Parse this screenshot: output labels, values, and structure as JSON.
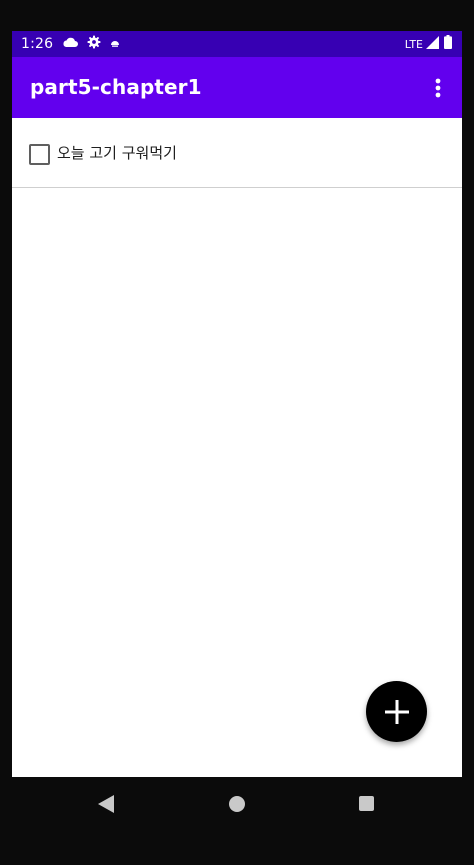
{
  "status_bar": {
    "time": "1:26",
    "network": "LTE",
    "icons": [
      "cloud-icon",
      "gear-icon",
      "sync-icon",
      "signal-icon",
      "battery-icon"
    ],
    "background": "#3700b3"
  },
  "app_bar": {
    "title": "part5-chapter1",
    "background": "#6200ee",
    "overflow_icon": "more-vert-icon"
  },
  "todo_list": {
    "items": [
      {
        "label": "오늘 고기 구워먹기",
        "checked": false
      }
    ]
  },
  "fab": {
    "icon": "add-icon",
    "background": "#000000"
  },
  "navigation_bar": {
    "buttons": [
      "back-icon",
      "home-icon",
      "recents-icon"
    ]
  }
}
